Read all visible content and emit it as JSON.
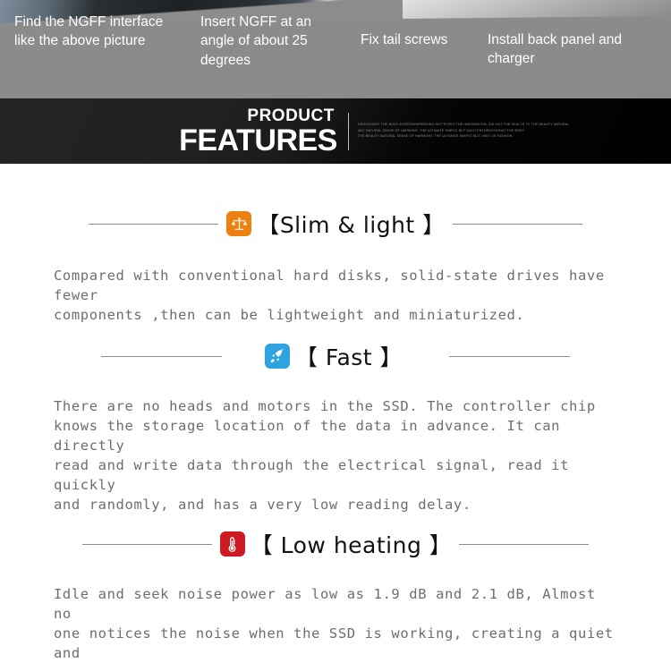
{
  "photo_strip": {
    "captions": [
      {
        "text": "Find the NGFF interface like the above picture"
      },
      {
        "text": "Insert NGFF at an angle of about 25 degrees"
      },
      {
        "text": "Fix tail screws"
      },
      {
        "text": "Install back panel and charger"
      }
    ]
  },
  "banner": {
    "product": "PRODUCT",
    "features": "FEATURES",
    "subtext_lines": [
      "HROUGHOUT THE BODY  EVERYWHEREBEING NOT EXPEC THE IMAGINATION, DID OUT THE HEALTH TO THE BEAUTY NATURAL",
      "ABC NATURAL SENSE OF HARMONY,  THE ULTIMATE SIMPLE BUT EACH ENTHROUGHOUT THE BODY",
      "THE BEAUTY NATURAL SENSE OF HARMONY,  THE ULTIMATE SIMPLE BUT LIMIT LIE FASHION"
    ]
  },
  "sections": [
    {
      "title": "【Slim & light 】",
      "icon_name": "balance-scale-icon",
      "icon_color": "#ee8012",
      "body": "Compared with conventional hard disks, solid-state drives have fewer\ncomponents ,then can be lightweight and miniaturized."
    },
    {
      "title": "【 Fast 】",
      "icon_name": "rocket-icon",
      "icon_color": "#2fa3e0",
      "body": "There are no heads and motors in the SSD. The controller chip\nknows the storage location of the data in advance. It can directly\nread and write data through the electrical signal, read it quickly\nand randomly, and has a very low reading delay."
    },
    {
      "title": "【 Low heating 】",
      "icon_name": "thermometer-icon",
      "icon_color": "#cd1b23",
      "body": "Idle and seek noise power as low as 1.9 dB and 2.1 dB, Almost no\none notices the noise when the SSD is working, creating a quiet and"
    }
  ]
}
